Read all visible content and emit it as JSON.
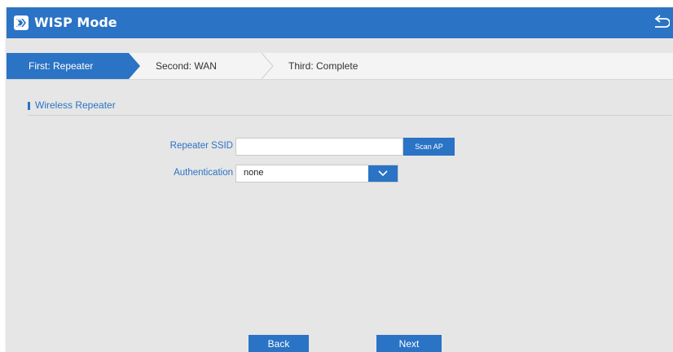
{
  "header": {
    "title": "WISP Mode",
    "app_icon": "wisp-logo-icon",
    "back_icon": "return-arrow-icon",
    "bar_color": "#2b73c4"
  },
  "steps": [
    {
      "label": "First: Repeater",
      "active": true
    },
    {
      "label": "Second: WAN",
      "active": false
    },
    {
      "label": "Third: Complete",
      "active": false
    }
  ],
  "section": {
    "title": "Wireless Repeater"
  },
  "form": {
    "ssid_label": "Repeater SSID",
    "ssid_value": "",
    "scan_button": "Scan AP",
    "auth_label": "Authentication",
    "auth_selected": "none",
    "dropdown_icon": "chevron-down-icon"
  },
  "footer": {
    "back_button": "Back",
    "next_button": "Next"
  },
  "colors": {
    "accent": "#2b73c4",
    "background": "#e6e6e6"
  }
}
